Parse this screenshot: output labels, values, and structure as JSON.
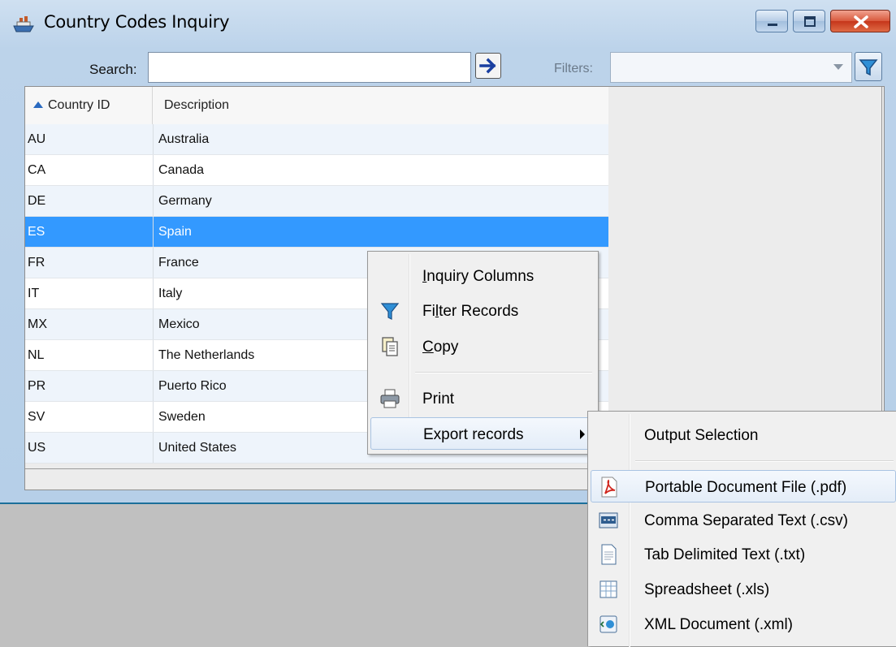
{
  "window": {
    "title": "Country Codes Inquiry",
    "icons": {
      "app": "ship-icon",
      "minimize": "minimize-icon",
      "maximize": "maximize-icon",
      "close": "close-icon"
    }
  },
  "toolbar": {
    "search_label": "Search:",
    "search_value": "",
    "go_icon": "arrow-right-icon",
    "filters_label": "Filters:",
    "filters_value": "",
    "filter_icon": "funnel-icon"
  },
  "grid": {
    "columns": [
      "Country ID",
      "Description"
    ],
    "sort_column": "Country ID",
    "sort_direction": "ascending",
    "rows": [
      {
        "id": "AU",
        "desc": "Australia"
      },
      {
        "id": "CA",
        "desc": "Canada"
      },
      {
        "id": "DE",
        "desc": "Germany"
      },
      {
        "id": "ES",
        "desc": "Spain",
        "selected": true
      },
      {
        "id": "FR",
        "desc": "France"
      },
      {
        "id": "IT",
        "desc": "Italy"
      },
      {
        "id": "MX",
        "desc": "Mexico"
      },
      {
        "id": "NL",
        "desc": "The Netherlands"
      },
      {
        "id": "PR",
        "desc": "Puerto Rico"
      },
      {
        "id": "SV",
        "desc": "Sweden"
      },
      {
        "id": "US",
        "desc": "United States"
      }
    ]
  },
  "context_menu": {
    "items": [
      {
        "label": "Inquiry Columns",
        "icon": ""
      },
      {
        "label": "Filter Records",
        "icon": "funnel-icon"
      },
      {
        "label": "Copy",
        "icon": "copy-icon"
      },
      {
        "label": "Print",
        "icon": "printer-icon"
      },
      {
        "label": "Export records",
        "icon": "",
        "has_submenu": true
      }
    ]
  },
  "export_submenu": {
    "header": "Output Selection",
    "items": [
      {
        "label": "Portable Document File (.pdf)",
        "icon": "pdf-icon"
      },
      {
        "label": "Comma Separated Text (.csv)",
        "icon": "csv-icon"
      },
      {
        "label": "Tab Delimited Text (.txt)",
        "icon": "text-file-icon"
      },
      {
        "label": "Spreadsheet (.xls)",
        "icon": "spreadsheet-icon"
      },
      {
        "label": "XML Document (.xml)",
        "icon": "xml-icon"
      }
    ]
  },
  "colors": {
    "selection": "#3399ff",
    "accent": "#1a3fa0",
    "close": "#c6361b"
  }
}
